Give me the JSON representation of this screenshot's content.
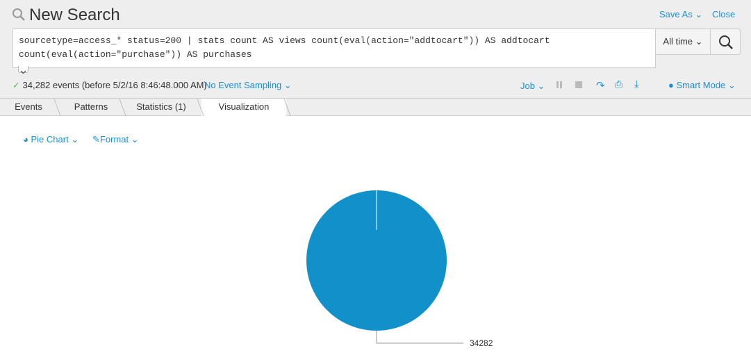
{
  "header": {
    "title": "New Search",
    "save_as": "Save As",
    "close": "Close"
  },
  "search": {
    "query_line1": "sourcetype=access_* status=200 | stats count AS views count(eval(action=\"addtocart\")) AS addtocart",
    "query_line2": "count(eval(action=\"purchase\")) AS purchases",
    "time_range": "All time"
  },
  "status": {
    "events": "34,282 events (before 5/2/16 8:46:48.000 AM)",
    "sampling": "No Event Sampling",
    "job": "Job",
    "mode": "Smart Mode"
  },
  "tabs": [
    {
      "label": "Events"
    },
    {
      "label": "Patterns"
    },
    {
      "label": "Statistics (1)"
    },
    {
      "label": "Visualization",
      "active": true
    }
  ],
  "viz_toolbar": {
    "chart_type": "Pie Chart",
    "format": "Format"
  },
  "accent": "#1a8fd4",
  "chart_data": {
    "type": "pie",
    "slices": [
      {
        "label": "34282",
        "value": 34282,
        "color": "#1190c9"
      }
    ]
  }
}
